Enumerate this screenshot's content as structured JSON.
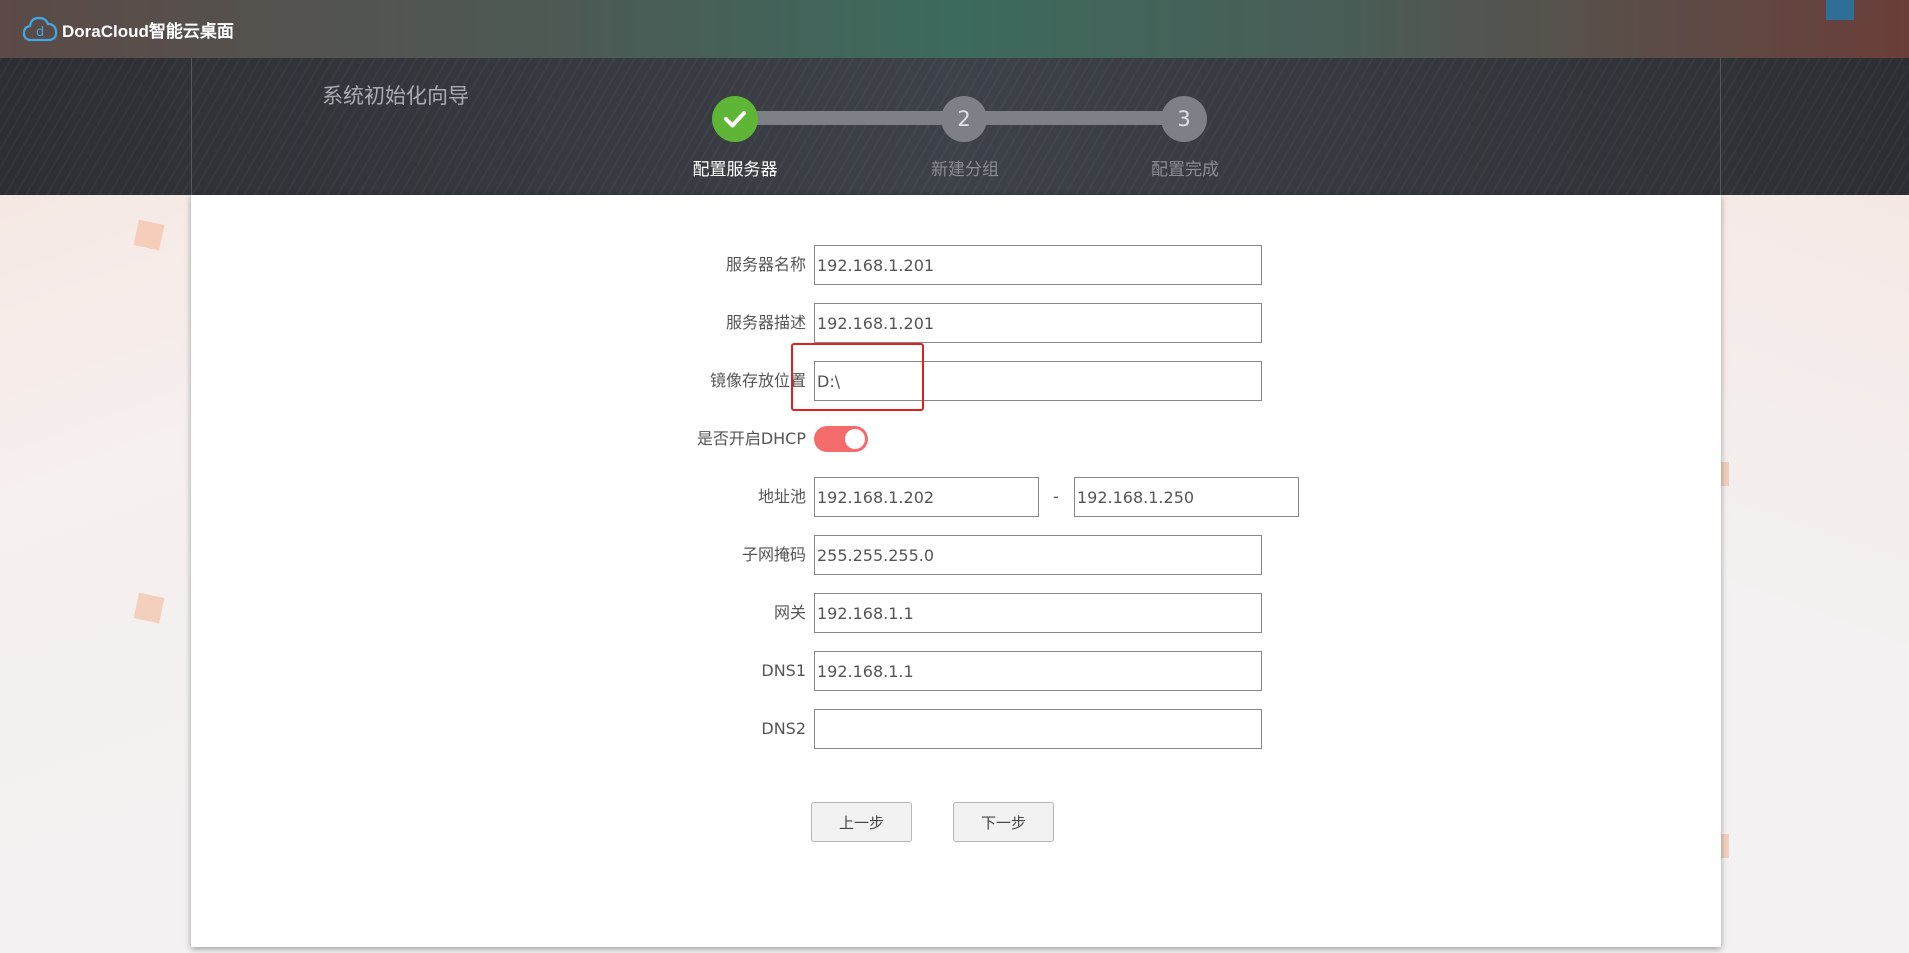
{
  "app": {
    "logo_letter": "d",
    "title": "DoraCloud智能云桌面"
  },
  "wizard": {
    "title": "系统初始化向导",
    "steps": [
      {
        "number": "",
        "label": "配置服务器",
        "state": "done"
      },
      {
        "number": "2",
        "label": "新建分组",
        "state": "pending"
      },
      {
        "number": "3",
        "label": "配置完成",
        "state": "pending"
      }
    ]
  },
  "form": {
    "server_name": {
      "label": "服务器名称",
      "value": "192.168.1.201"
    },
    "server_desc": {
      "label": "服务器描述",
      "value": "192.168.1.201"
    },
    "image_path": {
      "label": "镜像存放位置",
      "value": "D:\\"
    },
    "dhcp": {
      "label": "是否开启DHCP",
      "enabled": true
    },
    "address_pool": {
      "label": "地址池",
      "start": "192.168.1.202",
      "separator": "-",
      "end": "192.168.1.250"
    },
    "subnet_mask": {
      "label": "子网掩码",
      "value": "255.255.255.0"
    },
    "gateway": {
      "label": "网关",
      "value": "192.168.1.1"
    },
    "dns1": {
      "label": "DNS1",
      "value": "192.168.1.1"
    },
    "dns2": {
      "label": "DNS2",
      "value": ""
    }
  },
  "buttons": {
    "prev": "上一步",
    "next": "下一步"
  },
  "colors": {
    "step_done": "#5fb536",
    "step_pending": "#7d8086",
    "toggle_on": "#f36b6b",
    "highlight": "#e02020"
  }
}
